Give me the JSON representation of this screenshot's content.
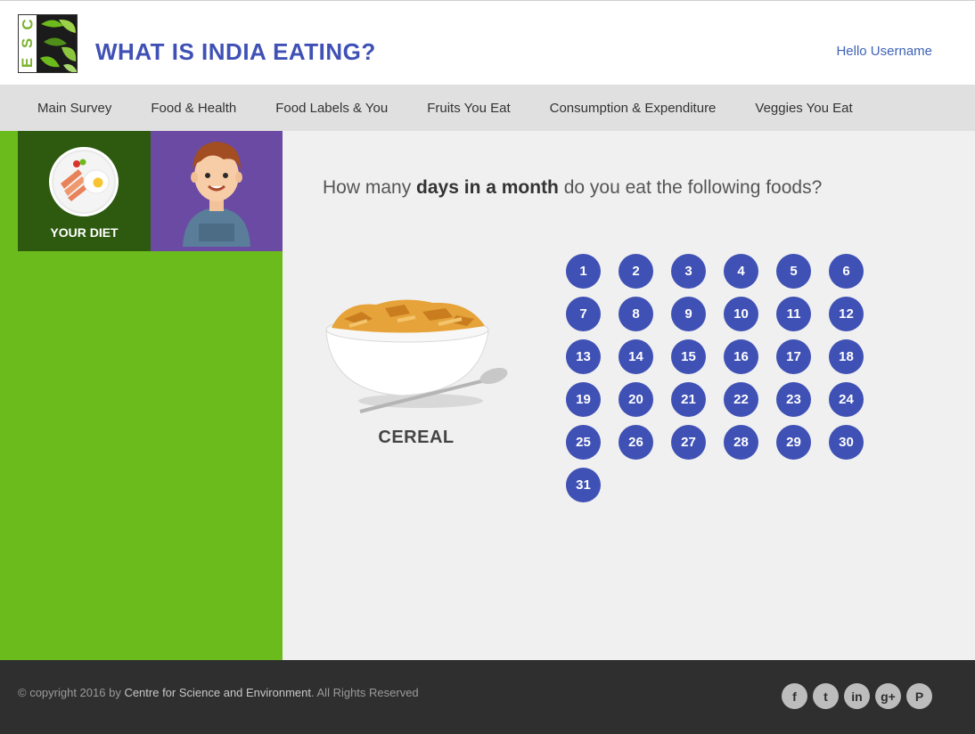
{
  "header": {
    "logo_text": "CSE",
    "title": "WHAT IS INDIA EATING?",
    "greeting": "Hello Username"
  },
  "nav": {
    "items": [
      {
        "label": "Main Survey"
      },
      {
        "label": "Food & Health"
      },
      {
        "label": "Food Labels & You"
      },
      {
        "label": "Fruits You Eat"
      },
      {
        "label": "Consumption & Expenditure"
      },
      {
        "label": "Veggies You Eat"
      }
    ]
  },
  "sidebar": {
    "diet_label": "YOUR DIET",
    "colors": {
      "panel": "#6cbb1c",
      "diet_tile": "#2e5a10",
      "avatar_tile": "#6a4aa3"
    }
  },
  "question": {
    "prefix": "How many ",
    "emphasis": "days in a month",
    "suffix": " do you eat the following foods?"
  },
  "food": {
    "label": "CEREAL",
    "image_icon": "cereal-bowl-image"
  },
  "days": [
    "1",
    "2",
    "3",
    "4",
    "5",
    "6",
    "7",
    "8",
    "9",
    "10",
    "11",
    "12",
    "13",
    "14",
    "15",
    "16",
    "17",
    "18",
    "19",
    "20",
    "21",
    "22",
    "23",
    "24",
    "25",
    "26",
    "27",
    "28",
    "29",
    "30",
    "31"
  ],
  "footer": {
    "copyright_prefix": "© copyright 2016 by ",
    "organization": "Centre for Science and Environment",
    "rights": ". All Rights Reserved",
    "socials": [
      {
        "icon": "facebook-icon",
        "glyph": "f"
      },
      {
        "icon": "twitter-icon",
        "glyph": "t"
      },
      {
        "icon": "linkedin-icon",
        "glyph": "in"
      },
      {
        "icon": "google-plus-icon",
        "glyph": "g+"
      },
      {
        "icon": "pinterest-icon",
        "glyph": "P"
      }
    ]
  },
  "colors": {
    "accent": "#3f51b5",
    "footer": "#2f2f2f",
    "nav": "#e0e0e0"
  }
}
